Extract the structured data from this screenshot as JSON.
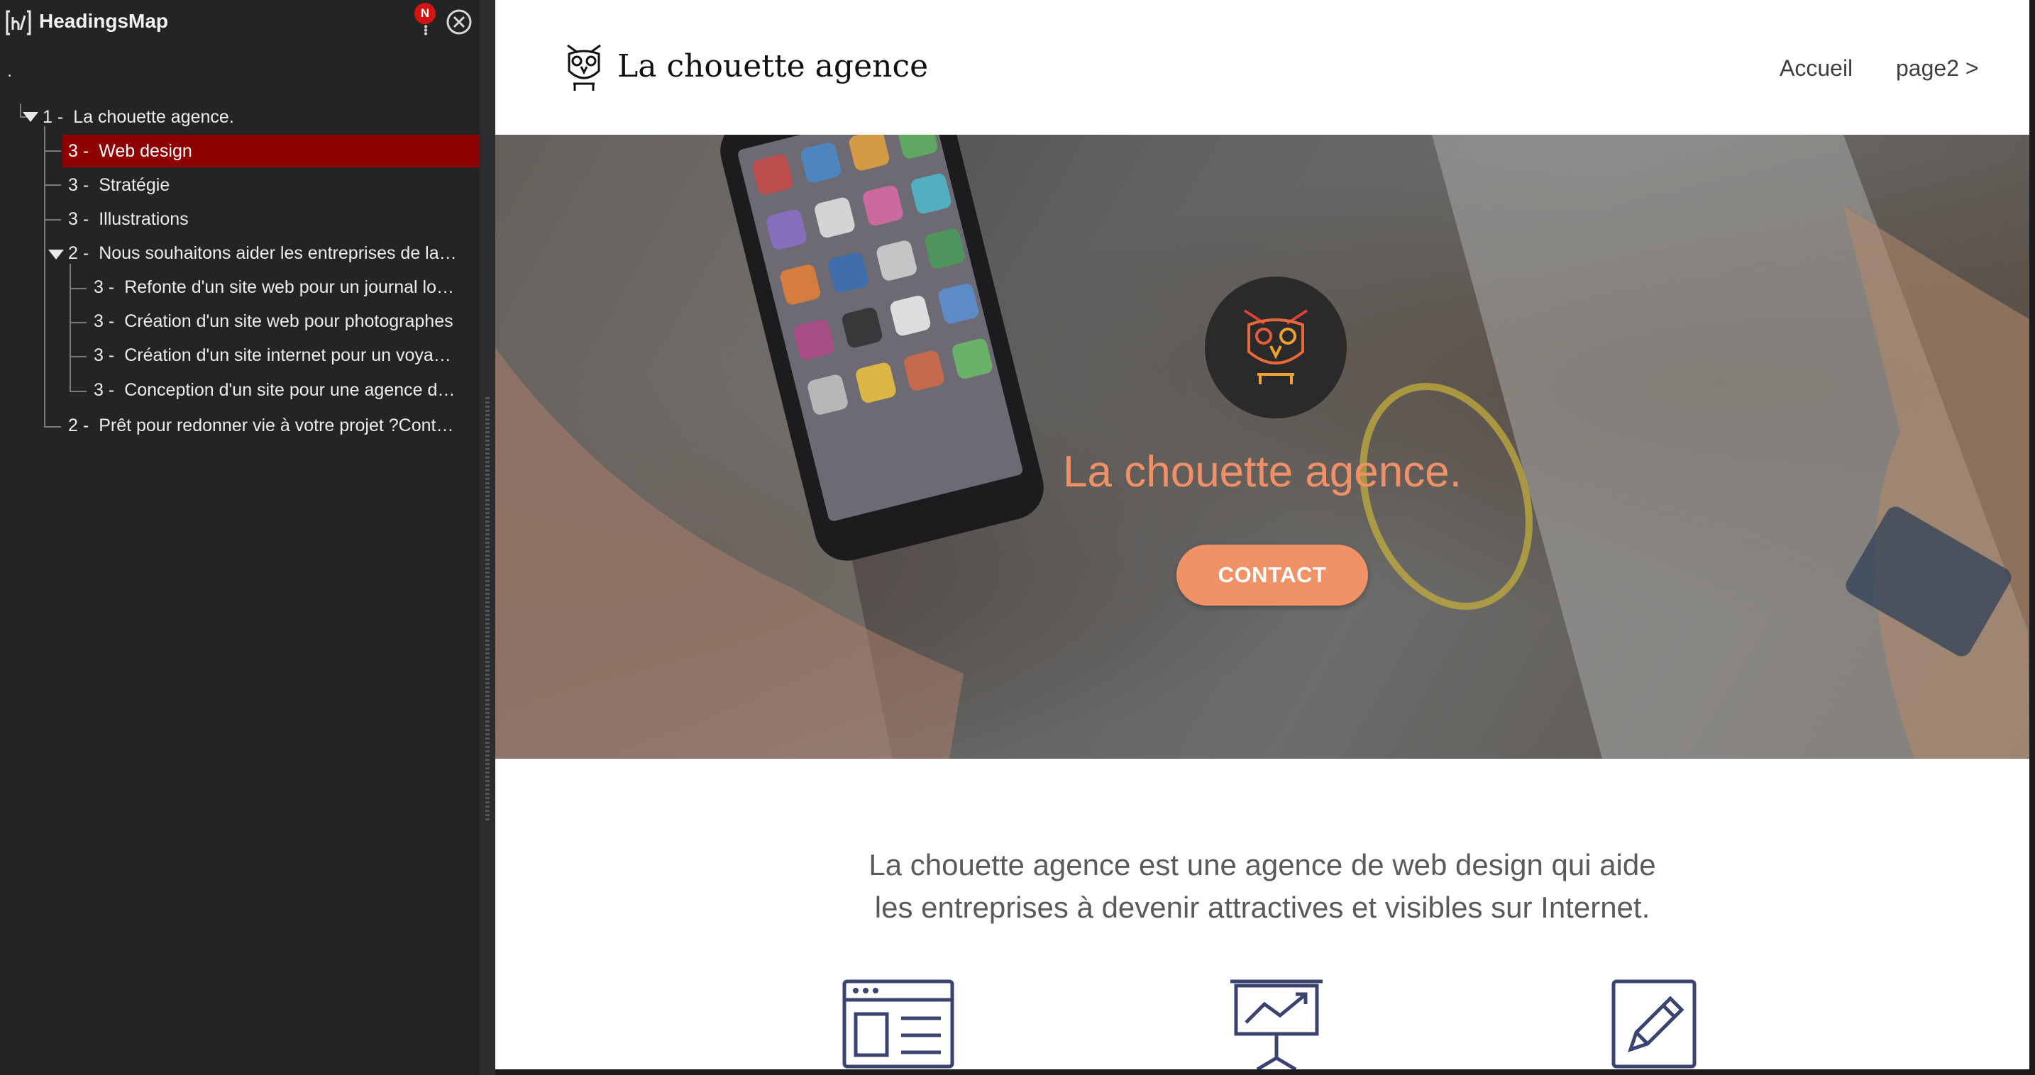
{
  "headingsmap": {
    "title": "HeadingsMap",
    "badge": "N",
    "root_marker": ".",
    "tree": [
      {
        "level": "1 -",
        "text": "La chouette agence."
      },
      {
        "level": "3 -",
        "text": "Web design",
        "active": true
      },
      {
        "level": "3 -",
        "text": "Stratégie"
      },
      {
        "level": "3 -",
        "text": "Illustrations"
      },
      {
        "level": "2 -",
        "text": "Nous souhaitons aider les entreprises de la…"
      },
      {
        "level": "3 -",
        "text": "Refonte d'un site web pour un journal lo…"
      },
      {
        "level": "3 -",
        "text": "Création d'un site web pour photographes"
      },
      {
        "level": "3 -",
        "text": "Création d'un site internet pour un voya…"
      },
      {
        "level": "3 -",
        "text": "Conception d'un site pour une agence d…"
      },
      {
        "level": "2 -",
        "text": "Prêt pour redonner vie à votre projet ?Cont…"
      }
    ],
    "active_color": "#8f0000",
    "badge_color": "#d41313"
  },
  "site": {
    "brand": "La chouette agence",
    "nav": {
      "home": "Accueil",
      "page2": "page2 >"
    },
    "hero": {
      "title": "La chouette agence.",
      "cta": "CONTACT",
      "accent": "#f19166"
    },
    "intro": {
      "line1": "La chouette agence est une agence de web design qui aide",
      "line2": "les entreprises à devenir attractives et visibles sur Internet."
    },
    "services_icons": [
      "web-layout-icon",
      "presentation-chart-icon",
      "pencil-icon"
    ]
  }
}
